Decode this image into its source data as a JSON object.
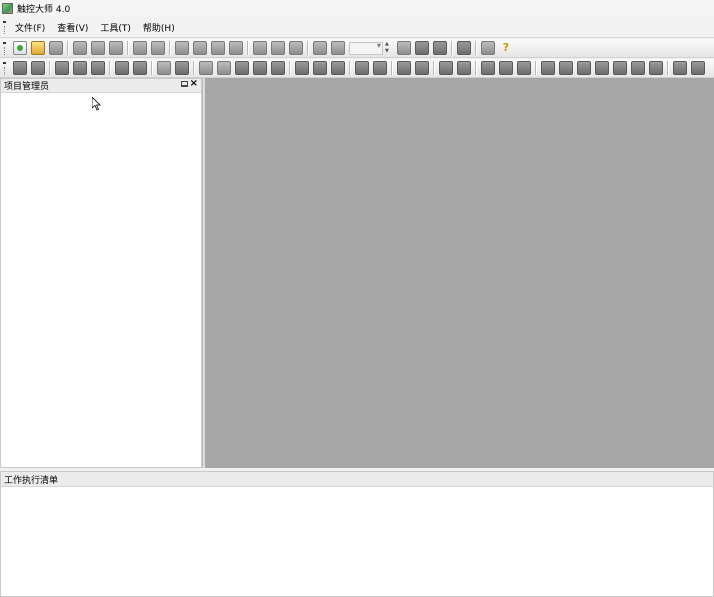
{
  "window": {
    "title": "触控大师 4.0",
    "icon": "app-icon"
  },
  "menu": [
    "文件(F)",
    "查看(V)",
    "工具(T)",
    "帮助(H)"
  ],
  "project_panel": {
    "title": "项目管理员",
    "pin_icon": "pin-icon",
    "close_icon": "close-icon"
  },
  "task_panel": {
    "title": "工作执行清单"
  },
  "colors": {
    "workspace": "#a8a7a8",
    "panel": "#ffffff",
    "chrome": "#f0f0f0"
  }
}
